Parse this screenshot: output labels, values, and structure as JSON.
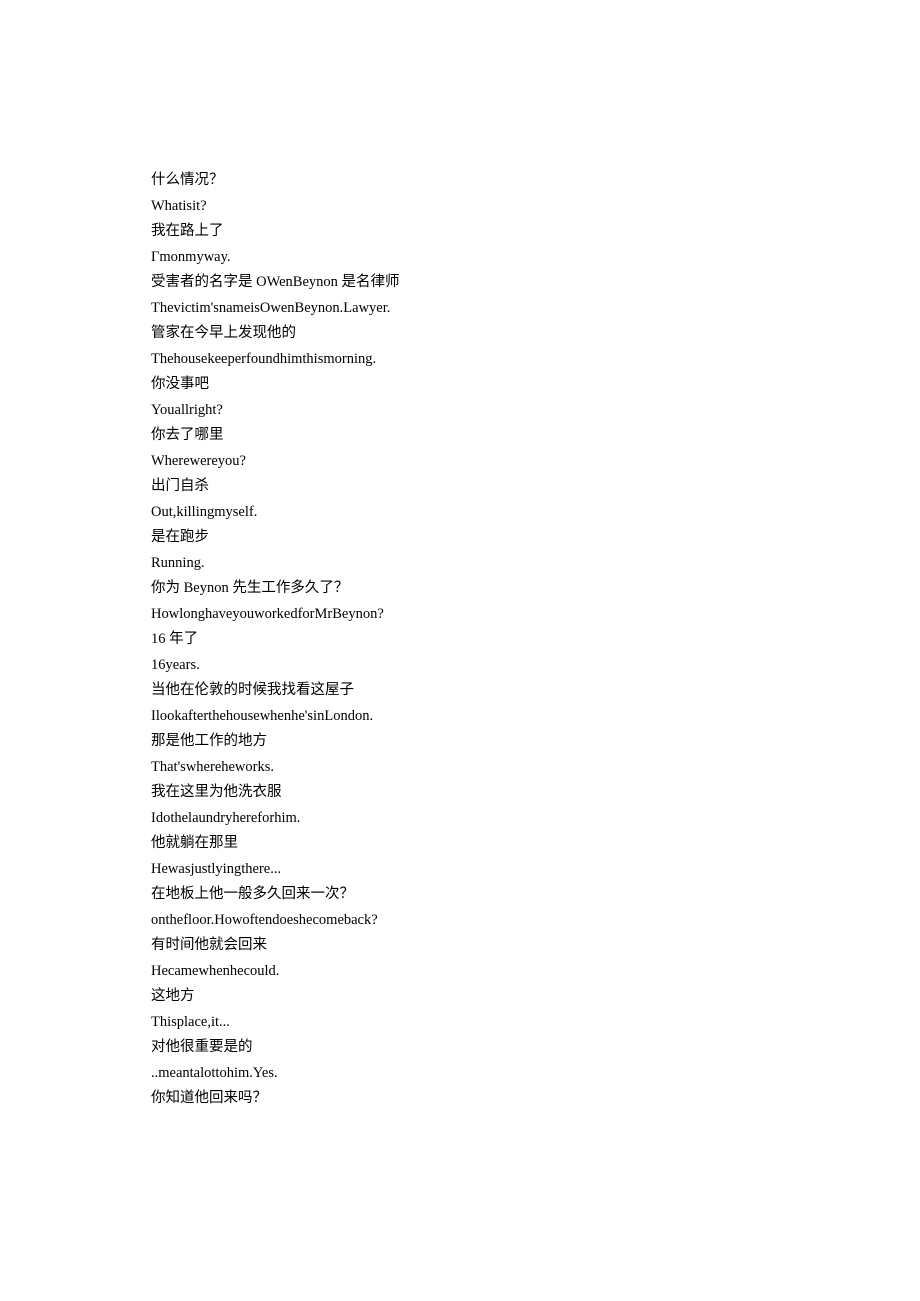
{
  "lines": [
    "什么情况？",
    "Whatisit?",
    "我在路上了",
    "Гmonmyway.",
    "受害者的名字是 OWenBeynon 是名律师",
    "Thevictim'snameisOwenBeynon.Lawyer.",
    "管家在今早上发现他的",
    "Thehousekeeperfoundhimthismorning.",
    "你没事吧",
    "Youallright?",
    "你去了哪里",
    "Wherewereyou?",
    "出门自杀",
    "Out,killingmyself.",
    "是在跑步",
    "Running.",
    "你为 Beynon 先生工作多久了？",
    "HowlonghaveyouworkedforMrBeynon?",
    "16 年了",
    "16years.",
    "当他在伦敦的时候我找看这屋子",
    "Ilookafterthehousewhenhe'sinLondon.",
    "那是他工作的地方",
    "That'swhereheworks.",
    "我在这里为他洗衣服",
    "Idothelaundryhereforhim.",
    "他就躺在那里",
    "Hewasjustlyingthere...",
    "在地板上他一般多久回来一次？",
    "onthefloor.Howoftendoeshecomeback?",
    "有时间他就会回来",
    "Hecamewhenhecould.",
    "这地方",
    "Thisplace,it...",
    "对他很重要是的",
    "..meantalottohim.Yes.",
    "你知道他回来吗？"
  ]
}
